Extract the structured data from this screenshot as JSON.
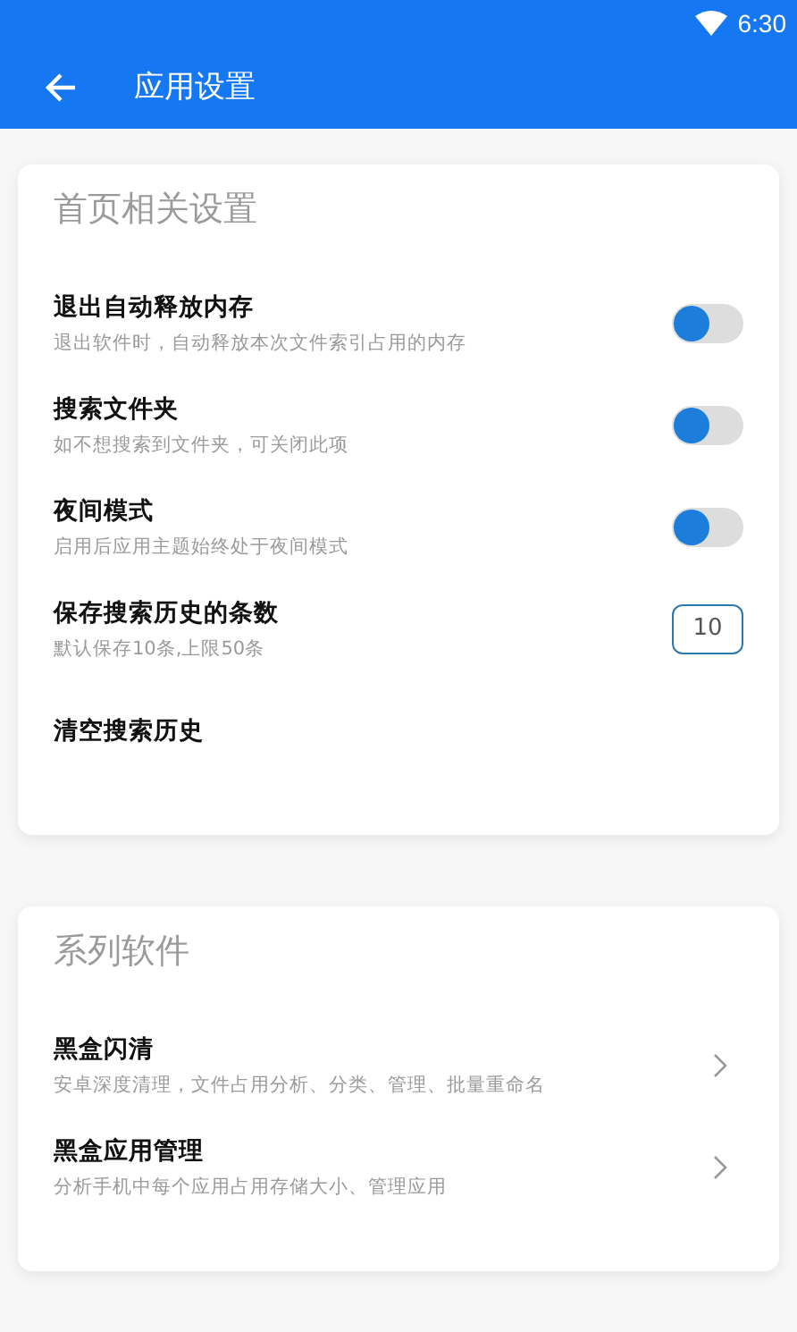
{
  "status_bar": {
    "time": "6:30"
  },
  "app_bar": {
    "title": "应用设置"
  },
  "sections": [
    {
      "title": "首页相关设置",
      "items": [
        {
          "kind": "switch",
          "title": "退出自动释放内存",
          "subtitle": "退出软件时，自动释放本次文件索引占用的内存",
          "on": false
        },
        {
          "kind": "switch",
          "title": "搜索文件夹",
          "subtitle": "如不想搜索到文件夹，可关闭此项",
          "on": false
        },
        {
          "kind": "switch",
          "title": "夜间模式",
          "subtitle": "启用后应用主题始终处于夜间模式",
          "on": false
        },
        {
          "kind": "number",
          "title": "保存搜索历史的条数",
          "subtitle": "默认保存10条,上限50条",
          "value": "10"
        },
        {
          "kind": "action",
          "title": "清空搜索历史"
        }
      ]
    },
    {
      "title": "系列软件",
      "items": [
        {
          "kind": "link",
          "title": "黑盒闪清",
          "subtitle": "安卓深度清理，文件占用分析、分类、管理、批量重命名"
        },
        {
          "kind": "link",
          "title": "黑盒应用管理",
          "subtitle": "分析手机中每个应用占用存储大小、管理应用"
        }
      ]
    }
  ]
}
